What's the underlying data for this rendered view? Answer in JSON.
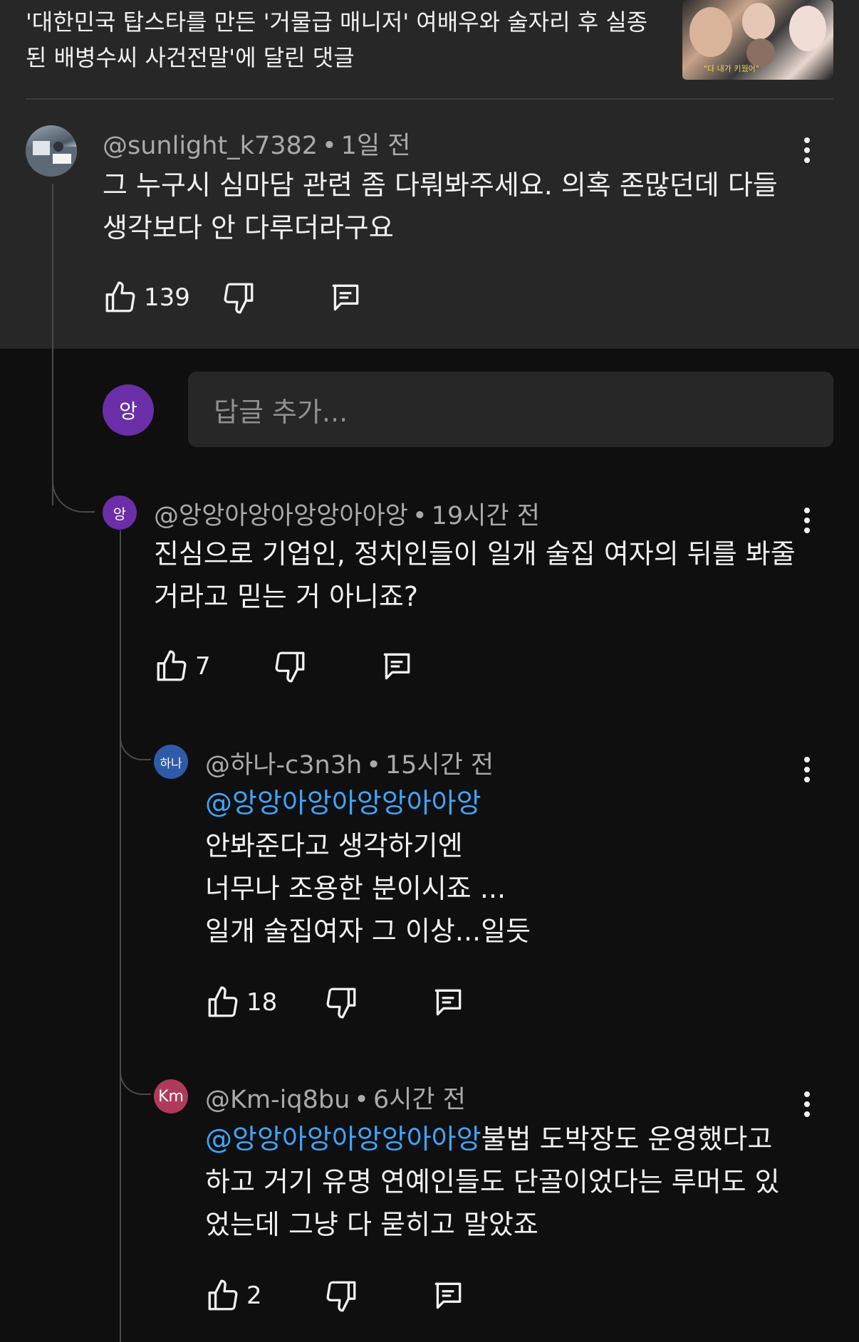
{
  "video": {
    "title": "'대한민국 탑스타를 만든 '거물급 매니저' 여배우와 술자리 후 실종된 배병수씨 사건전말'에 달린 댓글",
    "thumb_caption": "\"다 내가 키웠어\""
  },
  "main_comment": {
    "handle": "@sunlight_k7382",
    "time": "1일 전",
    "text": "그 누구시 심마담 관련 좀 다뤄봐주세요.  의혹 존많던데 다들 생각보다 안 다루더라구요",
    "likes": "139"
  },
  "reply_input": {
    "avatar_text": "앙",
    "placeholder": "답글 추가..."
  },
  "replies": [
    {
      "avatar_text": "앙",
      "avatar_color": "#6a2fa8",
      "handle": "@앙앙아앙아앙앙아아앙",
      "time": "19시간 전",
      "mention": "",
      "text": "진심으로 기업인, 정치인들이 일개 술집 여자의 뒤를 봐줄거라고 믿는 거 아니죠?",
      "likes": "7"
    },
    {
      "avatar_text": "하나",
      "avatar_color": "#2f5aa8",
      "handle": "@하나-c3n3h",
      "time": "15시간 전",
      "mention": "@앙앙아앙아앙앙아아앙",
      "lines": [
        "안봐준다고 생각하기엔",
        "너무나 조용한 분이시죠 ...",
        "일개 술집여자 그 이상...일듯"
      ],
      "likes": "18"
    },
    {
      "avatar_text": "Km",
      "avatar_color": "#b03a5b",
      "handle": "@Km-iq8bu",
      "time": "6시간 전",
      "mention": "@앙앙아앙아앙앙아아앙",
      "text": "불법 도박장도 운영했다고 하고 거기 유명 연예인들도 단골이었다는 루머도 있었는데 그냥 다 묻히고 말았죠",
      "likes": "2"
    }
  ],
  "icons": {
    "like": "thumbs-up-icon",
    "dislike": "thumbs-down-icon",
    "reply": "comment-icon",
    "more": "more-vert-icon"
  },
  "colors": {
    "background": "#0f0f0f",
    "top_background": "#272727",
    "mention": "#3ea6ff"
  }
}
